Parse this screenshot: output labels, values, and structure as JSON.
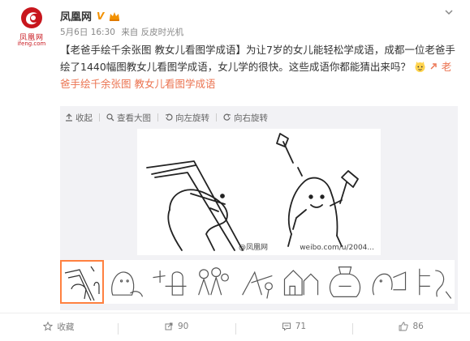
{
  "user": {
    "name": "凤凰网",
    "verified_badge": "V",
    "avatar_brand": "凤凰网",
    "avatar_url": "ifeng.com"
  },
  "meta": {
    "time": "5月6日 16:30",
    "via": "来自 反皮时光机"
  },
  "post": {
    "part1": "【老爸手绘千余张图 教女儿看图学成语】为让7岁的女儿能轻松学成语，成都一位老爸手绘了1440幅图教女儿看图学成语，女儿学的很快。这些成语你都能猜出来吗？",
    "link_text": "老爸手绘千余张图 教女儿看图学成语"
  },
  "toolbar": {
    "collapse": "收起",
    "view_large": "查看大图",
    "rotate_left": "向左旋转",
    "rotate_right": "向右旋转"
  },
  "image": {
    "watermark_left": "@凤凰网",
    "watermark_right": "weibo.com/u/2004..."
  },
  "footer": {
    "favorite": "收藏",
    "repost_count": "90",
    "comment_count": "71",
    "like_count": "86"
  },
  "colors": {
    "link": "#eb7350",
    "verified": "#f29100",
    "brand": "#c8161d",
    "active_thumb": "#ff8140"
  }
}
